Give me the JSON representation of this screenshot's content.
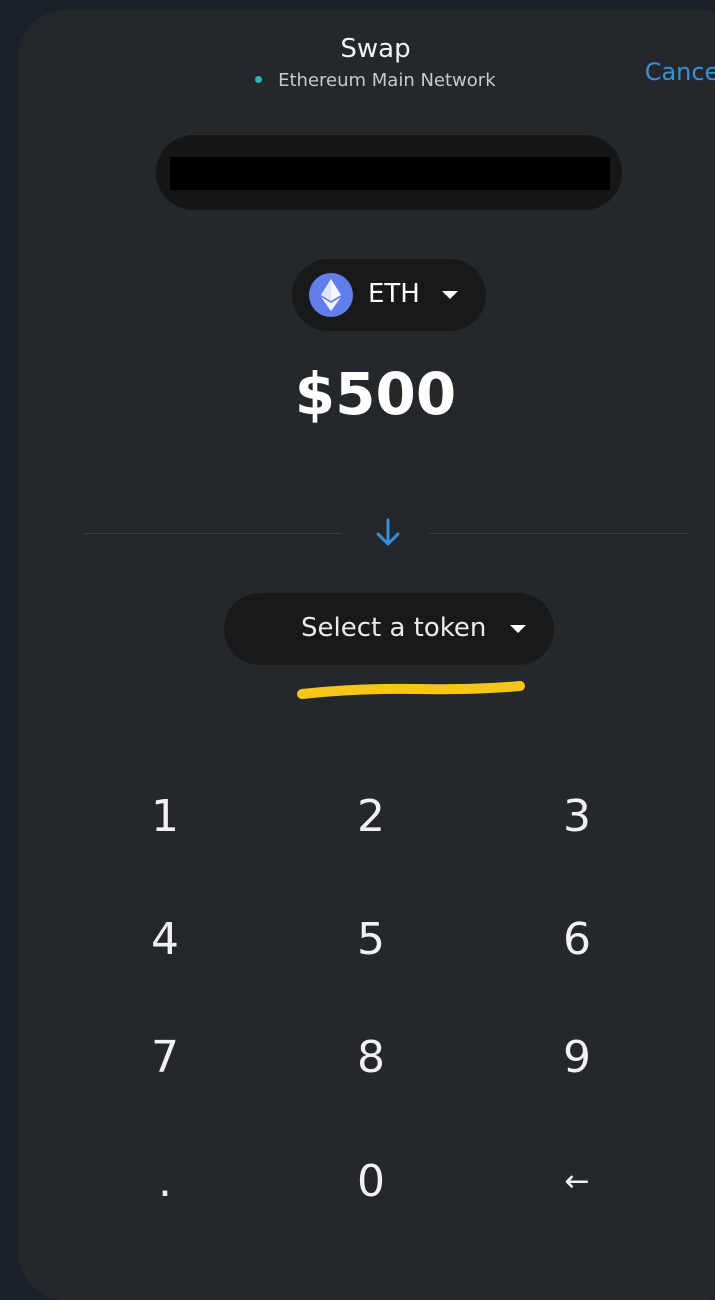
{
  "header": {
    "title": "Swap",
    "network": "Ethereum Main Network",
    "cancel_label": "Cancel"
  },
  "from_token": {
    "symbol": "ETH",
    "icon": "ethereum-icon"
  },
  "amount": "$500",
  "to_token": {
    "label": "Select a token"
  },
  "keypad": {
    "keys": [
      "1",
      "2",
      "3",
      "4",
      "5",
      "6",
      "7",
      "8",
      "9",
      ".",
      "0",
      "←"
    ]
  },
  "colors": {
    "accent": "#3a8fd9",
    "network_dot": "#29b6af",
    "highlight": "#f5c518",
    "eth": "#627eea"
  }
}
